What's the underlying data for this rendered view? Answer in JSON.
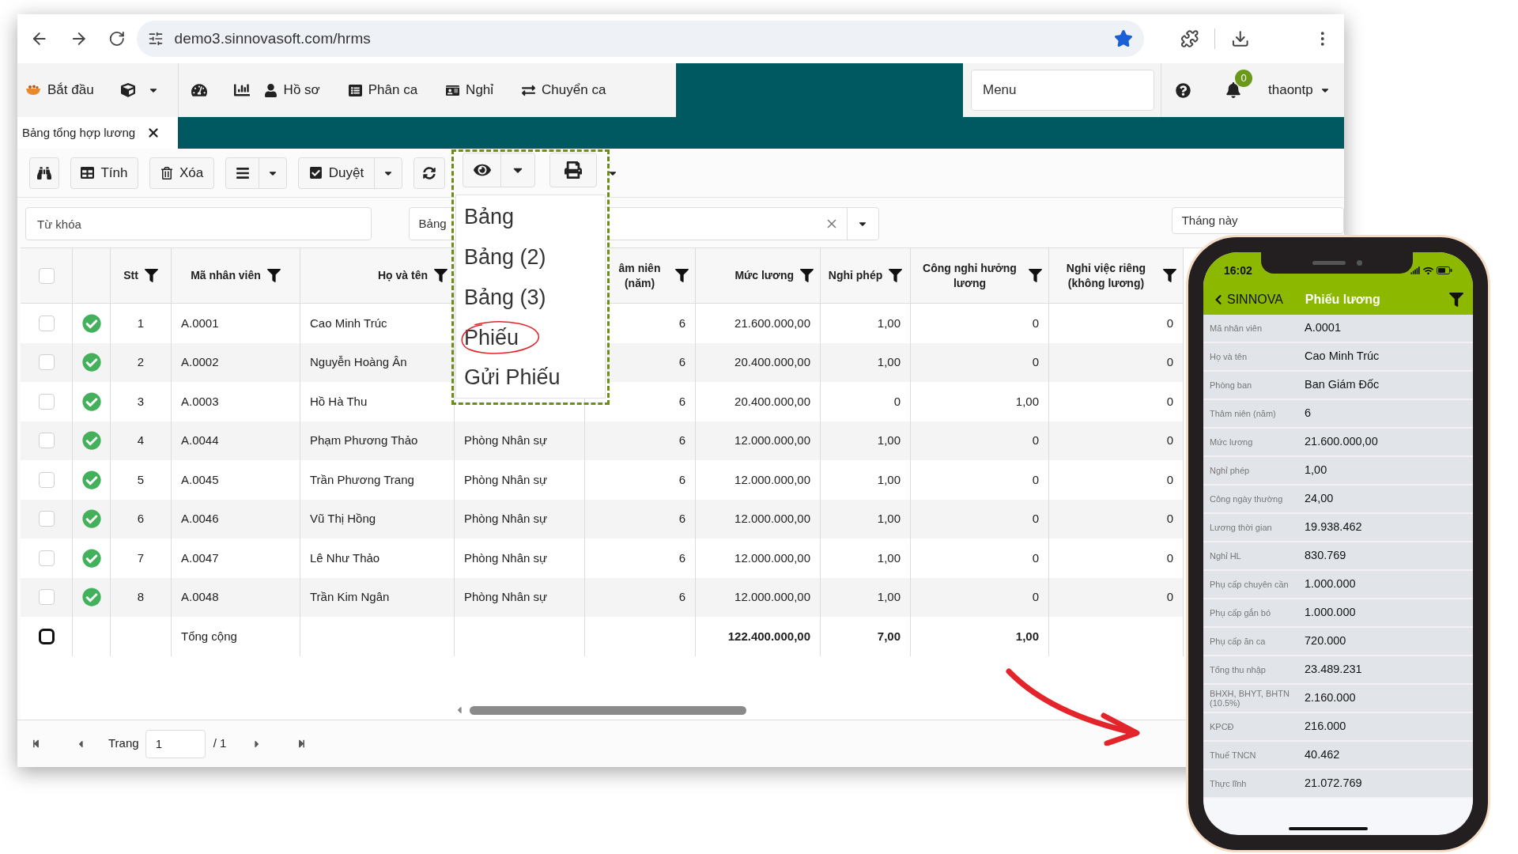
{
  "browser": {
    "url": "demo3.sinnovasoft.com/hrms",
    "bookmarked": true
  },
  "nav": {
    "items": [
      "Bắt đầu",
      "Hồ sơ",
      "Phân ca",
      "Nghỉ",
      "Chuyển ca"
    ],
    "menu_placeholder": "Menu",
    "notifications": "0",
    "user": "thaontp"
  },
  "tabs": [
    {
      "label": "Bảng tổng hợp lương",
      "selected": true
    }
  ],
  "toolbar": {
    "buttons": [
      "Tính",
      "Xóa",
      "Duyệt"
    ]
  },
  "filters": {
    "keyword_placeholder": "Từ khóa",
    "view": "Bảng",
    "period": "Tháng này"
  },
  "view_menu": {
    "items": [
      {
        "label": "Bảng",
        "circled": false
      },
      {
        "label": "Bảng (2)",
        "circled": false
      },
      {
        "label": "Bảng (3)",
        "circled": false
      },
      {
        "label": "Phiếu",
        "circled": true
      },
      {
        "label": "Gửi Phiếu",
        "circled": false
      }
    ]
  },
  "table": {
    "all_selected": false,
    "columns": [
      "Stt",
      "Mã nhân viên",
      "Họ và tên",
      "âm niên (năm)",
      "Mức lương",
      "Nghỉ phép",
      "Công nghỉ hưởng lương",
      "Nghỉ việc riêng (không lương)"
    ],
    "rows": [
      {
        "selected": false,
        "approved": true,
        "stt": "1",
        "code": "A.0001",
        "name": "Cao Minh Trúc",
        "seniority": "6",
        "salary": "21.600.000,00",
        "leave": "1,00",
        "paid_off": "0",
        "unpaid_off": "0"
      },
      {
        "selected": false,
        "approved": true,
        "stt": "2",
        "code": "A.0002",
        "name": "Nguyễn Hoàng Ân",
        "seniority": "6",
        "salary": "20.400.000,00",
        "leave": "1,00",
        "paid_off": "0",
        "unpaid_off": "0"
      },
      {
        "selected": false,
        "approved": true,
        "stt": "3",
        "code": "A.0003",
        "name": "Hồ Hà Thu",
        "seniority": "6",
        "salary": "20.400.000,00",
        "leave": "0",
        "paid_off": "1,00",
        "unpaid_off": "0"
      },
      {
        "selected": false,
        "approved": true,
        "stt": "4",
        "code": "A.0044",
        "name": "Phạm Phương Thảo",
        "department": "Phòng Nhân sự",
        "seniority": "6",
        "salary": "12.000.000,00",
        "leave": "1,00",
        "paid_off": "0",
        "unpaid_off": "0"
      },
      {
        "selected": false,
        "approved": true,
        "stt": "5",
        "code": "A.0045",
        "name": "Trần Phương Trang",
        "department": "Phòng Nhân sự",
        "seniority": "6",
        "salary": "12.000.000,00",
        "leave": "1,00",
        "paid_off": "0",
        "unpaid_off": "0"
      },
      {
        "selected": false,
        "approved": true,
        "stt": "6",
        "code": "A.0046",
        "name": "Vũ Thị Hồng",
        "department": "Phòng Nhân sự",
        "seniority": "6",
        "salary": "12.000.000,00",
        "leave": "1,00",
        "paid_off": "0",
        "unpaid_off": "0"
      },
      {
        "selected": false,
        "approved": true,
        "stt": "7",
        "code": "A.0047",
        "name": "Lê Như Thảo",
        "department": "Phòng Nhân sự",
        "seniority": "6",
        "salary": "12.000.000,00",
        "leave": "1,00",
        "paid_off": "0",
        "unpaid_off": "0"
      },
      {
        "selected": false,
        "approved": true,
        "stt": "8",
        "code": "A.0048",
        "name": "Trần Kim Ngân",
        "department": "Phòng Nhân sự",
        "seniority": "6",
        "salary": "12.000.000,00",
        "leave": "1,00",
        "paid_off": "0",
        "unpaid_off": "0"
      }
    ],
    "total": {
      "selected": false,
      "label": "Tổng cộng",
      "salary": "122.400.000,00",
      "leave": "7,00",
      "paid_off": "1,00"
    }
  },
  "pagination": {
    "label": "Trang",
    "page": "1",
    "of": "/ 1"
  },
  "phone": {
    "time": "16:02",
    "back": "SINNOVA",
    "title": "Phiếu lương",
    "fields": [
      {
        "label": "Mã nhân viên",
        "value": "A.0001"
      },
      {
        "label": "Họ và tên",
        "value": "Cao Minh Trúc"
      },
      {
        "label": "Phòng ban",
        "value": "Ban Giám Đốc"
      },
      {
        "label": "Thâm niên (năm)",
        "value": "6"
      },
      {
        "label": "Mức lương",
        "value": "21.600.000,00"
      },
      {
        "label": "Nghỉ phép",
        "value": "1,00"
      },
      {
        "label": "Công ngày thường",
        "value": "24,00"
      },
      {
        "label": "Lương thời gian",
        "value": "19.938.462"
      },
      {
        "label": "Nghỉ HL",
        "value": "830.769"
      },
      {
        "label": "Phụ cấp chuyên cần",
        "value": "1.000.000"
      },
      {
        "label": "Phụ cấp gắn bó",
        "value": "1.000.000"
      },
      {
        "label": "Phụ cấp ăn ca",
        "value": "720.000"
      },
      {
        "label": "Tổng thu nhập",
        "value": "23.489.231"
      },
      {
        "label": "BHXH, BHYT, BHTN (10.5%)",
        "value": "2.160.000"
      },
      {
        "label": "KPCĐ",
        "value": "216.000"
      },
      {
        "label": "Thuế TNCN",
        "value": "40.462"
      },
      {
        "label": "Thực lĩnh",
        "value": "21.072.769"
      }
    ]
  }
}
